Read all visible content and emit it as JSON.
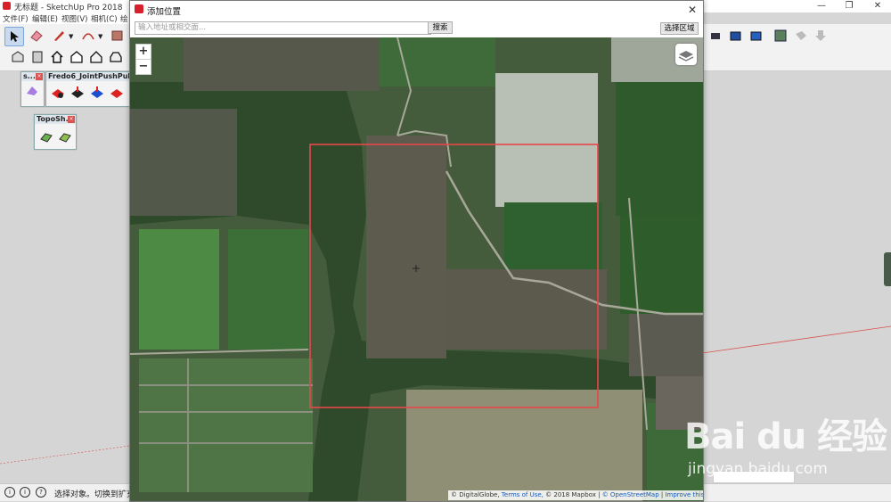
{
  "app": {
    "window_title": "无标题 - SketchUp Pro 2018",
    "menu": [
      "文件(F)",
      "编辑(E)",
      "视图(V)",
      "相机(C)",
      "绘"
    ],
    "status_text": "选择对象。切换到扩充"
  },
  "palettes": {
    "small_a": {
      "title": "s..."
    },
    "fredo": {
      "title": "Fredo6_JointPushPull"
    },
    "topo": {
      "title": "TopoSh..."
    }
  },
  "dialog": {
    "title": "添加位置",
    "search": {
      "placeholder": "输入地址或相交面...",
      "button": "搜索"
    },
    "select_area_button": "选择区域",
    "zoom_in": "+",
    "zoom_out": "−",
    "attribution": {
      "copyright": "© DigitalGlobe,",
      "terms": "Terms of Use,",
      "mapbox": "© 2018 Mapbox",
      "osm": "© OpenStreetMap",
      "improve": "Improve this map",
      "sep": "|"
    }
  },
  "watermark": {
    "logo": "Bai du 经验",
    "url": "jingyan.baidu.com"
  },
  "colors": {
    "selection_rect": "#e8474a",
    "su_red": "#d8202b"
  }
}
